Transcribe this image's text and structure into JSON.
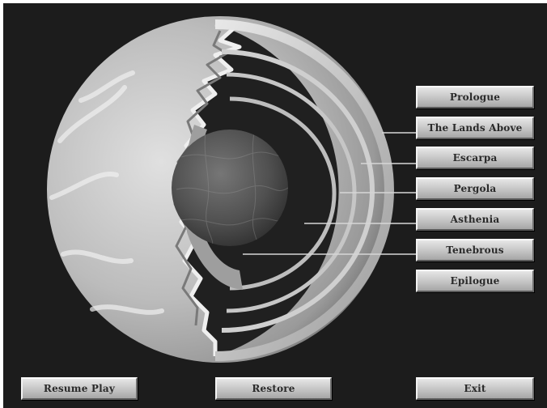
{
  "chapter_menu": {
    "items": [
      {
        "id": "prologue",
        "label": "Prologue"
      },
      {
        "id": "lands-above",
        "label": "The Lands Above"
      },
      {
        "id": "escarpa",
        "label": "Escarpa"
      },
      {
        "id": "pergola",
        "label": "Pergola"
      },
      {
        "id": "asthenia",
        "label": "Asthenia"
      },
      {
        "id": "tenebrous",
        "label": "Tenebrous"
      },
      {
        "id": "epilogue",
        "label": "Epilogue"
      }
    ]
  },
  "bottom_bar": {
    "resume_label": "Resume Play",
    "restore_label": "Restore",
    "exit_label": "Exit"
  },
  "colors": {
    "background": "#1c1c1c",
    "button_face": "#c4c4c4",
    "button_text": "#2a2a2a",
    "globe_crust": "#b4b4b4",
    "core": "#4a4a4a",
    "connector": "#d6d6d6"
  }
}
